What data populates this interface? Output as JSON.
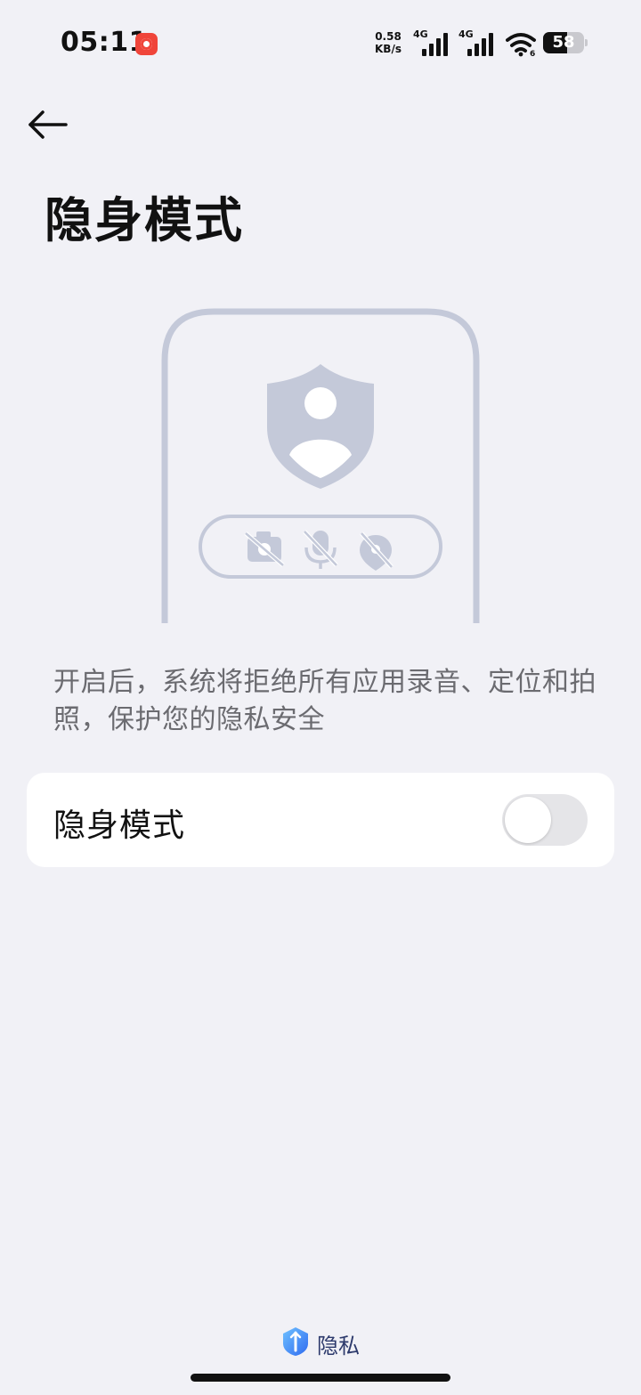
{
  "status_bar": {
    "time": "05:11",
    "net_speed_value": "0.58",
    "net_speed_unit": "KB/s",
    "signal_1_label": "4G",
    "signal_2_label": "4G",
    "wifi_badge": "6",
    "battery_level": "58",
    "battery_fraction": 0.58,
    "icons": [
      "screen-record-icon",
      "signal-icon",
      "signal-icon",
      "wifi-icon",
      "battery-icon"
    ]
  },
  "header": {
    "back_icon": "arrow-left-icon",
    "title": "隐身模式"
  },
  "illustration": {
    "icons": [
      "phone-outline",
      "shield-user-icon",
      "camera-off-icon",
      "mic-off-icon",
      "location-off-icon"
    ],
    "color": "#C4C9D9"
  },
  "description": "开启后，系统将拒绝所有应用录音、定位和拍照，保护您的隐私安全",
  "settings": {
    "stealth_mode_label": "隐身模式",
    "stealth_mode_enabled": false
  },
  "footer": {
    "brand_icon": "privacy-shield-icon",
    "brand_label": "隐私"
  },
  "colors": {
    "background": "#F1F1F6",
    "card": "#FFFFFF",
    "illustration": "#C4C9D9",
    "brand": "#2D3A6C",
    "record": "#F0453A"
  }
}
